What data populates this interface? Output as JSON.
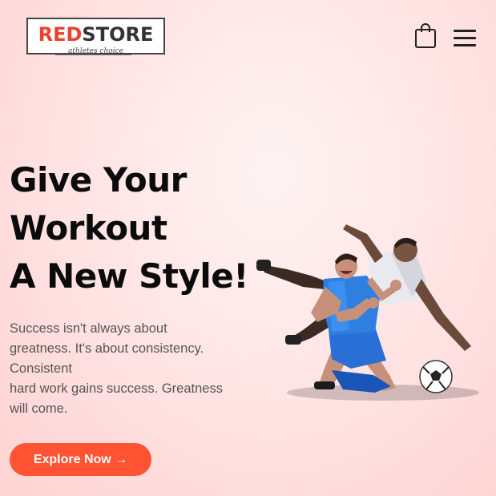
{
  "header": {
    "logo": {
      "brand_red": "RED",
      "brand_dark": "STORE",
      "tagline": "athletes choice"
    },
    "icons": {
      "cart": "shopping-bag-icon",
      "menu": "hamburger-menu-icon"
    }
  },
  "hero": {
    "title_lines": [
      "Give Your",
      "Workout",
      "A New Style!"
    ],
    "description_lines": [
      "Success isn't always about",
      "greatness. It's about consistency.",
      "Consistent",
      "hard work gains success. Greatness",
      "will come."
    ],
    "cta_label": "Explore Now →",
    "image": "football-players-illustration"
  },
  "colors": {
    "accent": "#ff5333",
    "logo_red": "#e8432f",
    "background": "#ffe2e2",
    "text_dark": "#0b0b0b",
    "text_muted": "#555555"
  }
}
